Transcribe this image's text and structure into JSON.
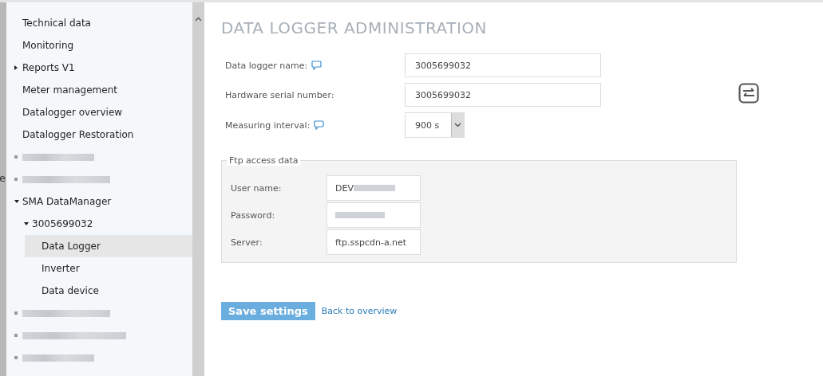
{
  "background_fragment": "e",
  "sidebar": {
    "items": [
      {
        "label": "Technical data",
        "selected": false
      },
      {
        "label": "Monitoring",
        "selected": false
      },
      {
        "label": "Reports V1",
        "selected": false,
        "expanded": false
      },
      {
        "label": "Meter management",
        "selected": false
      },
      {
        "label": "Datalogger overview",
        "selected": false
      },
      {
        "label": "Datalogger Restoration",
        "selected": false
      },
      {
        "kind": "redacted"
      },
      {
        "kind": "redacted"
      },
      {
        "label": "SMA DataManager",
        "selected": false,
        "expanded": true,
        "children": [
          {
            "label": "3005699032",
            "selected": false,
            "expanded": true,
            "children": [
              {
                "label": "Data Logger",
                "selected": true
              },
              {
                "label": "Inverter",
                "selected": false
              },
              {
                "label": "Data device",
                "selected": false
              }
            ]
          }
        ]
      },
      {
        "kind": "redacted"
      },
      {
        "kind": "redacted"
      },
      {
        "kind": "redacted"
      }
    ]
  },
  "title": "DATA LOGGER ADMINISTRATION",
  "fields": [
    {
      "kind": "text",
      "label": "Data logger name:",
      "info": true,
      "value": "3005699032"
    },
    {
      "kind": "text",
      "label": "Hardware serial number:",
      "info": false,
      "value": "3005699032"
    },
    {
      "kind": "select",
      "label": "Measuring interval:",
      "info": true,
      "value": "900 s"
    }
  ],
  "ftp": {
    "legend": "Ftp access data",
    "fields": [
      {
        "label": "User name:",
        "value": "DEV",
        "redacted": true
      },
      {
        "label": "Password:",
        "redacted": true
      },
      {
        "label": "Server:",
        "value": "ftp.sspcdn-a.net",
        "redacted": false
      }
    ]
  },
  "save_button": "Save settings",
  "back_link": "Back to overview"
}
